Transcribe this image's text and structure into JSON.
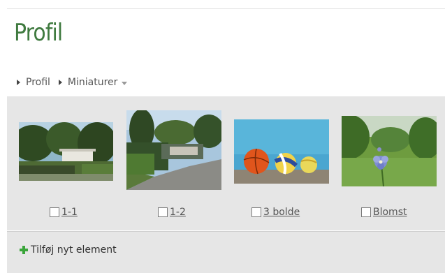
{
  "header": {
    "title": "Profil",
    "breadcrumb": [
      {
        "label": "Profil"
      },
      {
        "label": "Miniaturer"
      }
    ]
  },
  "gallery": {
    "items": [
      {
        "label": "1-1",
        "icon": "garden-house-photo"
      },
      {
        "label": "1-2",
        "icon": "garden-road-photo"
      },
      {
        "label": "3 bolde",
        "icon": "three-balls-photo"
      },
      {
        "label": "Blomst",
        "icon": "blue-flower-photo"
      }
    ]
  },
  "footer": {
    "add_label": "Tilføj nyt element",
    "add_icon": "green-plus-icon"
  },
  "colors": {
    "title_green": "#3f7a3f",
    "panel_gray": "#e6e6e6",
    "plus_green": "#3aa53a"
  }
}
